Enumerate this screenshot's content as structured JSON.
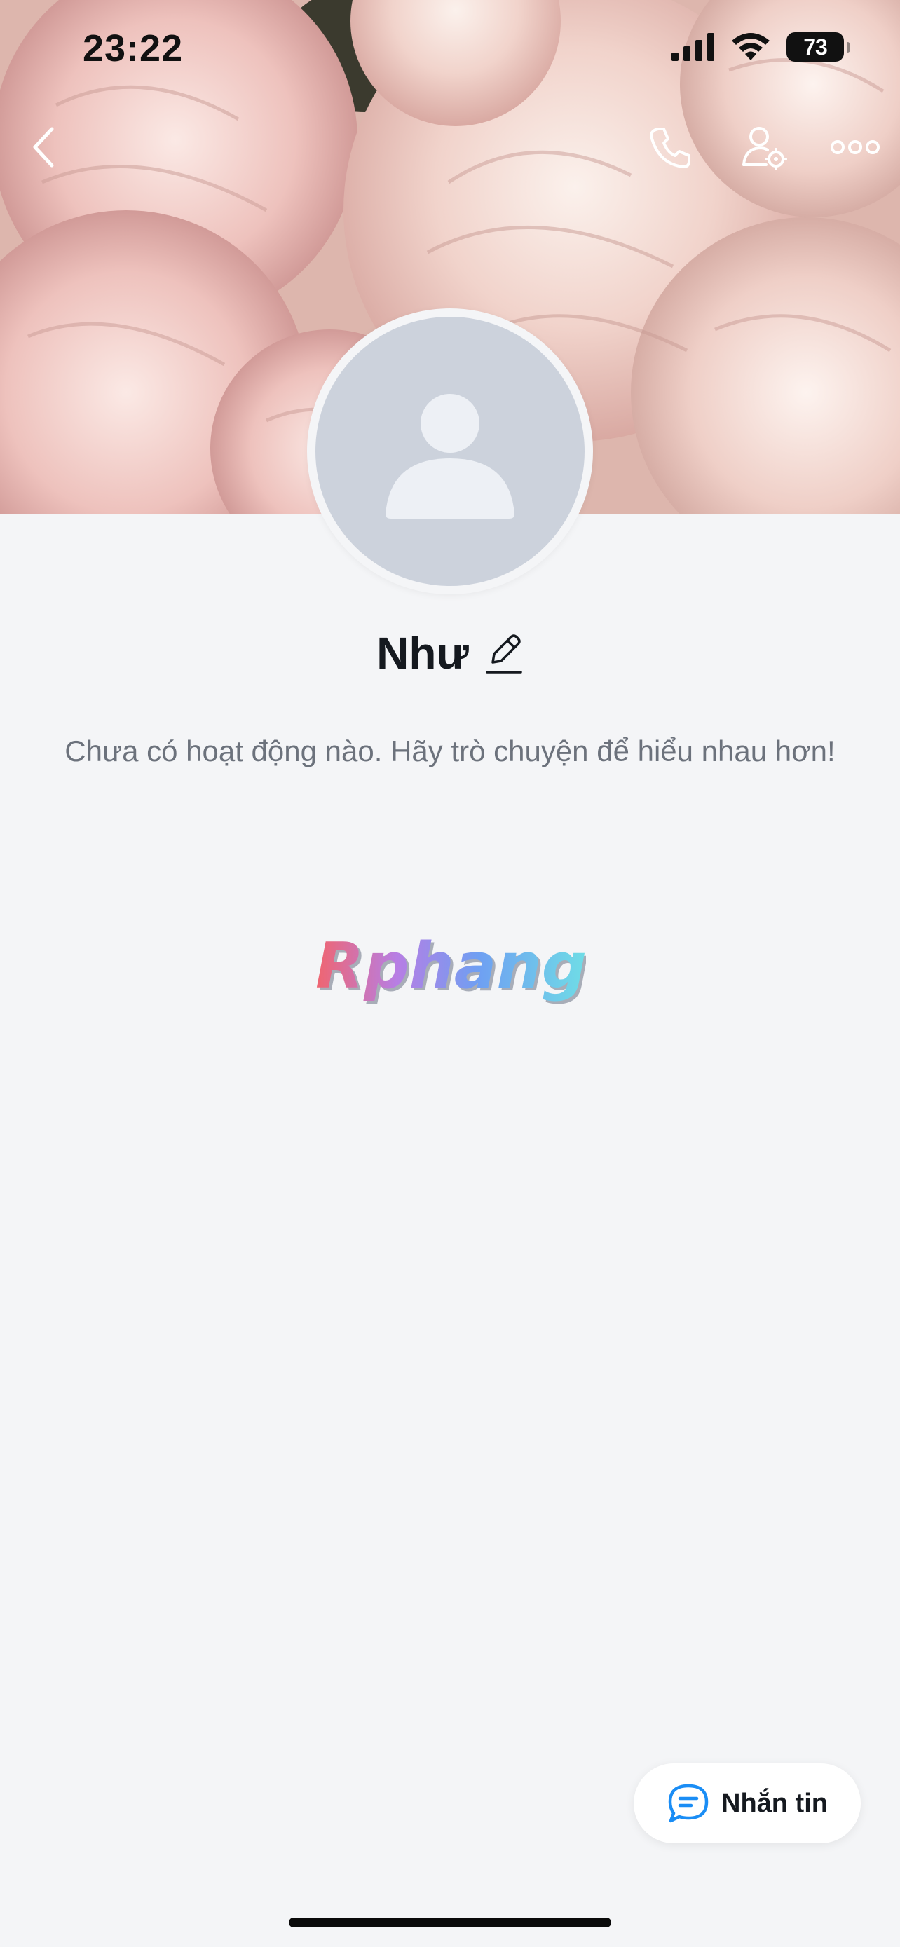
{
  "status_bar": {
    "time": "23:22",
    "battery_level": "73",
    "icons": [
      "cellular-signal-icon",
      "wifi-icon",
      "battery-icon"
    ]
  },
  "nav": {
    "back_icon": "chevron-left-icon",
    "call_icon": "phone-icon",
    "settings_icon": "user-settings-icon",
    "more_icon": "more-horizontal-icon"
  },
  "profile": {
    "name": "Như",
    "edit_icon": "pencil-icon",
    "activity_message": "Chưa có hoạt động nào. Hãy trò chuyện để hiểu nhau hơn!",
    "avatar_icon": "default-person-icon"
  },
  "watermark": {
    "text": "Rphang"
  },
  "message_button": {
    "label": "Nhắn tin",
    "icon": "chat-bubble-icon"
  },
  "colors": {
    "background": "#f4f5f7",
    "accent": "#1a8df5",
    "text_primary": "#15191f",
    "text_secondary": "#6c727c",
    "avatar_placeholder": "#ccd2dc"
  }
}
